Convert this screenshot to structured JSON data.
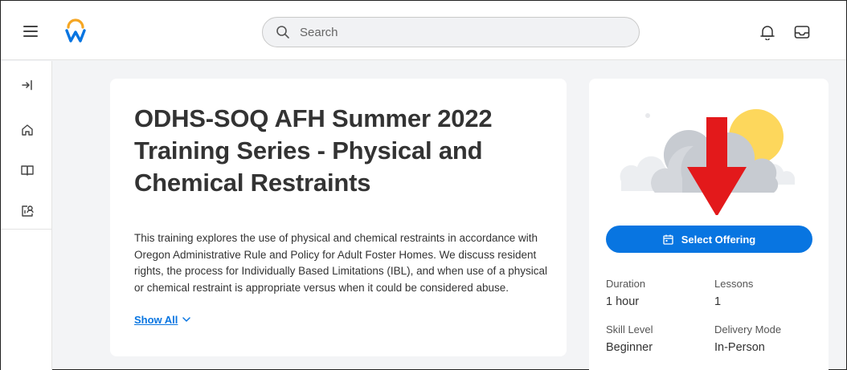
{
  "header": {
    "search": {
      "placeholder": "Search"
    }
  },
  "course": {
    "title": "ODHS-SOQ AFH Summer 2022 Training Series - Physical and Chemical Restraints",
    "description": "This training explores the use of physical and chemical restraints in accordance with Oregon Administrative Rule and Policy for Adult Foster Homes. We discuss resident rights, the process for Individually Based Limitations (IBL), and when use of a physical or chemical restraint is appropriate versus when it could be considered abuse.",
    "show_all_label": "Show All"
  },
  "offering": {
    "select_label": "Select Offering",
    "details": [
      {
        "label": "Duration",
        "value": "1 hour"
      },
      {
        "label": "Lessons",
        "value": "1"
      },
      {
        "label": "Skill Level",
        "value": "Beginner"
      },
      {
        "label": "Delivery Mode",
        "value": "In-Person"
      }
    ]
  },
  "colors": {
    "accent": "#0875e1",
    "arrow": "#e3191b",
    "sun": "#fdd75c",
    "cloud": "#c7cbd1"
  },
  "icons": [
    "hamburger-menu-icon",
    "workday-logo",
    "search-icon",
    "bell-icon",
    "inbox-icon",
    "expand-rail-icon",
    "home-icon",
    "book-icon",
    "learning-dashboard-icon",
    "chevron-down-icon",
    "calendar-icon"
  ]
}
